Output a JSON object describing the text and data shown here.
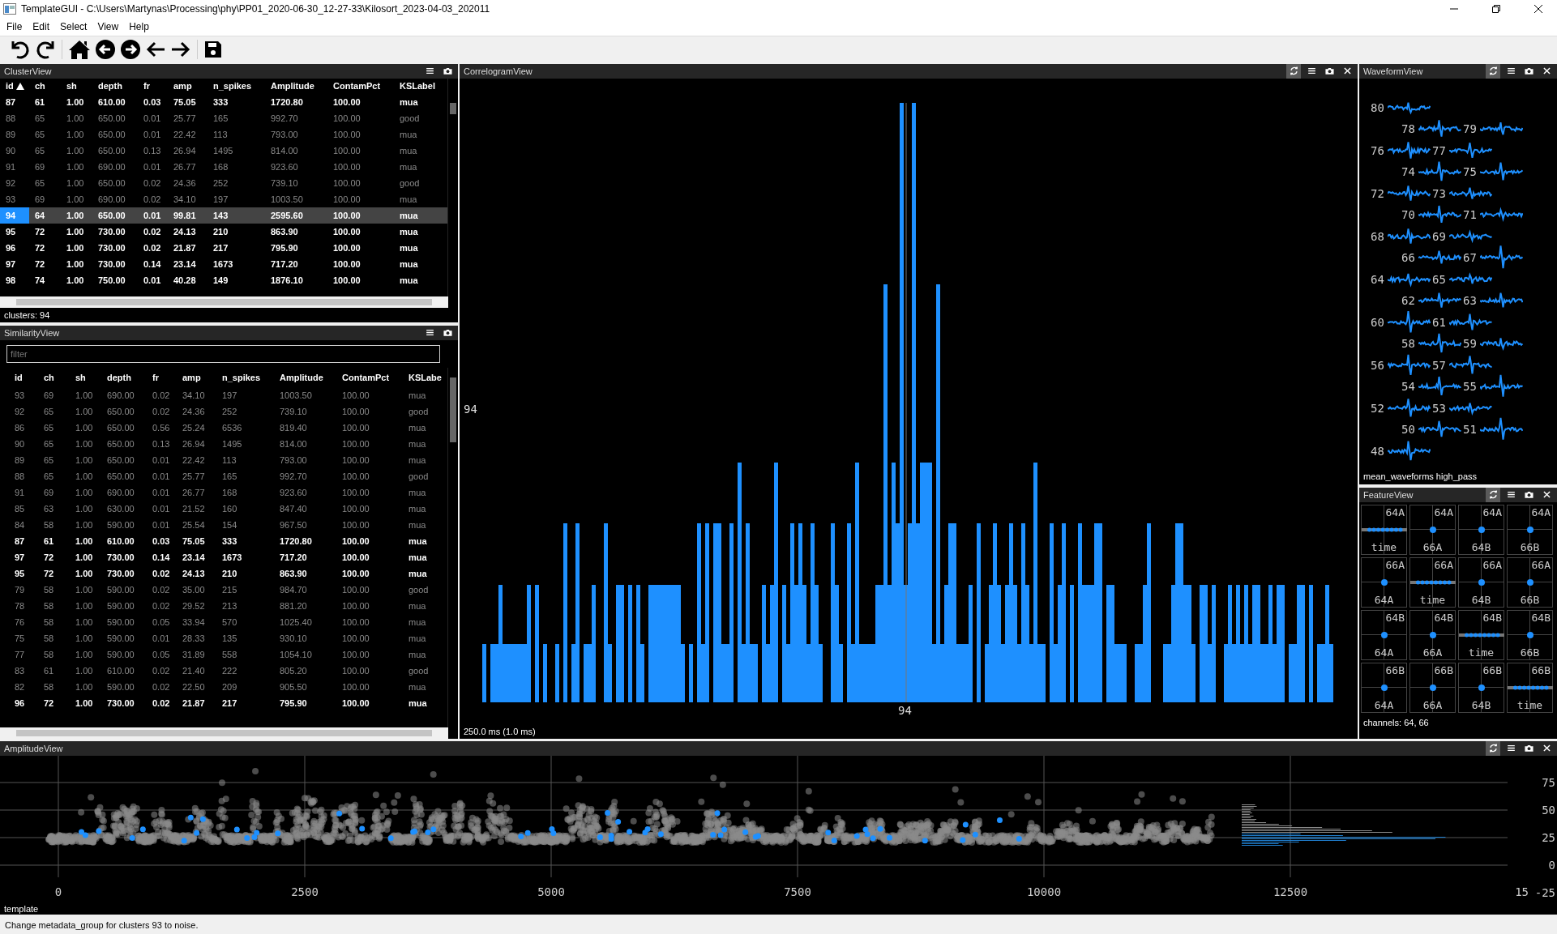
{
  "window": {
    "title": "TemplateGUI - C:\\Users\\Martynas\\Processing\\phy\\PP01_2020-06-30_12-27-33\\Kilosort_2023-04-03_202011"
  },
  "menu": [
    "File",
    "Edit",
    "Select",
    "View",
    "Help"
  ],
  "cluster_view": {
    "title": "ClusterView",
    "closable": false,
    "columns": [
      {
        "label": "id",
        "sorted": true
      },
      {
        "label": "ch",
        "sorted": false
      },
      {
        "label": "sh",
        "sorted": false
      },
      {
        "label": "depth",
        "sorted": false
      },
      {
        "label": "fr",
        "sorted": false
      },
      {
        "label": "amp",
        "sorted": false
      },
      {
        "label": "n_spikes",
        "sorted": false
      },
      {
        "label": "Amplitude",
        "sorted": false
      },
      {
        "label": "ContamPct",
        "sorted": false
      },
      {
        "label": "KSLabel",
        "sorted": false
      }
    ],
    "rows": [
      {
        "cells": [
          "87",
          "61",
          "1.00",
          "610.00",
          "0.03",
          "75.05",
          "333",
          "1720.80",
          "100.00",
          "mua"
        ],
        "emphasized": true,
        "selected": false
      },
      {
        "cells": [
          "88",
          "65",
          "1.00",
          "650.00",
          "0.01",
          "25.77",
          "165",
          "992.70",
          "100.00",
          "good"
        ],
        "emphasized": false,
        "selected": false
      },
      {
        "cells": [
          "89",
          "65",
          "1.00",
          "650.00",
          "0.01",
          "22.42",
          "113",
          "793.00",
          "100.00",
          "mua"
        ],
        "emphasized": false,
        "selected": false
      },
      {
        "cells": [
          "90",
          "65",
          "1.00",
          "650.00",
          "0.13",
          "26.94",
          "1495",
          "814.00",
          "100.00",
          "mua"
        ],
        "emphasized": false,
        "selected": false
      },
      {
        "cells": [
          "91",
          "69",
          "1.00",
          "690.00",
          "0.01",
          "26.77",
          "168",
          "923.60",
          "100.00",
          "mua"
        ],
        "emphasized": false,
        "selected": false
      },
      {
        "cells": [
          "92",
          "65",
          "1.00",
          "650.00",
          "0.02",
          "24.36",
          "252",
          "739.10",
          "100.00",
          "good"
        ],
        "emphasized": false,
        "selected": false
      },
      {
        "cells": [
          "93",
          "69",
          "1.00",
          "690.00",
          "0.02",
          "34.10",
          "197",
          "1003.50",
          "100.00",
          "mua"
        ],
        "emphasized": false,
        "selected": false
      },
      {
        "cells": [
          "94",
          "64",
          "1.00",
          "650.00",
          "0.01",
          "99.81",
          "143",
          "2595.60",
          "100.00",
          "mua"
        ],
        "emphasized": true,
        "selected": true
      },
      {
        "cells": [
          "95",
          "72",
          "1.00",
          "730.00",
          "0.02",
          "24.13",
          "210",
          "863.90",
          "100.00",
          "mua"
        ],
        "emphasized": true,
        "selected": false
      },
      {
        "cells": [
          "96",
          "72",
          "1.00",
          "730.00",
          "0.02",
          "21.87",
          "217",
          "795.90",
          "100.00",
          "mua"
        ],
        "emphasized": true,
        "selected": false
      },
      {
        "cells": [
          "97",
          "72",
          "1.00",
          "730.00",
          "0.14",
          "23.14",
          "1673",
          "717.20",
          "100.00",
          "mua"
        ],
        "emphasized": true,
        "selected": false
      },
      {
        "cells": [
          "98",
          "74",
          "1.00",
          "750.00",
          "0.01",
          "40.28",
          "149",
          "1876.10",
          "100.00",
          "mua"
        ],
        "emphasized": true,
        "selected": false
      }
    ],
    "footer": "clusters: 94"
  },
  "similarity_view": {
    "title": "SimilarityView",
    "closable": false,
    "filter": {
      "placeholder": "filter"
    },
    "columns": [
      {
        "label": "id"
      },
      {
        "label": "ch"
      },
      {
        "label": "sh"
      },
      {
        "label": "depth"
      },
      {
        "label": "fr"
      },
      {
        "label": "amp"
      },
      {
        "label": "n_spikes"
      },
      {
        "label": "Amplitude"
      },
      {
        "label": "ContamPct"
      },
      {
        "label": "KSLabe"
      }
    ],
    "rows": [
      {
        "cells": [
          "93",
          "69",
          "1.00",
          "690.00",
          "0.02",
          "34.10",
          "197",
          "1003.50",
          "100.00",
          "mua"
        ],
        "emphasized": false,
        "selected": false
      },
      {
        "cells": [
          "92",
          "65",
          "1.00",
          "650.00",
          "0.02",
          "24.36",
          "252",
          "739.10",
          "100.00",
          "good"
        ],
        "emphasized": false,
        "selected": false
      },
      {
        "cells": [
          "86",
          "65",
          "1.00",
          "650.00",
          "0.56",
          "25.24",
          "6536",
          "819.40",
          "100.00",
          "mua"
        ],
        "emphasized": false,
        "selected": false
      },
      {
        "cells": [
          "90",
          "65",
          "1.00",
          "650.00",
          "0.13",
          "26.94",
          "1495",
          "814.00",
          "100.00",
          "mua"
        ],
        "emphasized": false,
        "selected": false
      },
      {
        "cells": [
          "89",
          "65",
          "1.00",
          "650.00",
          "0.01",
          "22.42",
          "113",
          "793.00",
          "100.00",
          "mua"
        ],
        "emphasized": false,
        "selected": false
      },
      {
        "cells": [
          "88",
          "65",
          "1.00",
          "650.00",
          "0.01",
          "25.77",
          "165",
          "992.70",
          "100.00",
          "good"
        ],
        "emphasized": false,
        "selected": false
      },
      {
        "cells": [
          "91",
          "69",
          "1.00",
          "690.00",
          "0.01",
          "26.77",
          "168",
          "923.60",
          "100.00",
          "mua"
        ],
        "emphasized": false,
        "selected": false
      },
      {
        "cells": [
          "85",
          "63",
          "1.00",
          "630.00",
          "0.01",
          "21.52",
          "160",
          "847.40",
          "100.00",
          "mua"
        ],
        "emphasized": false,
        "selected": false
      },
      {
        "cells": [
          "84",
          "58",
          "1.00",
          "590.00",
          "0.01",
          "25.54",
          "154",
          "967.50",
          "100.00",
          "mua"
        ],
        "emphasized": false,
        "selected": false
      },
      {
        "cells": [
          "87",
          "61",
          "1.00",
          "610.00",
          "0.03",
          "75.05",
          "333",
          "1720.80",
          "100.00",
          "mua"
        ],
        "emphasized": true,
        "selected": false
      },
      {
        "cells": [
          "97",
          "72",
          "1.00",
          "730.00",
          "0.14",
          "23.14",
          "1673",
          "717.20",
          "100.00",
          "mua"
        ],
        "emphasized": true,
        "selected": false
      },
      {
        "cells": [
          "95",
          "72",
          "1.00",
          "730.00",
          "0.02",
          "24.13",
          "210",
          "863.90",
          "100.00",
          "mua"
        ],
        "emphasized": true,
        "selected": false
      },
      {
        "cells": [
          "79",
          "58",
          "1.00",
          "590.00",
          "0.02",
          "35.00",
          "215",
          "984.70",
          "100.00",
          "good"
        ],
        "emphasized": false,
        "selected": false
      },
      {
        "cells": [
          "78",
          "58",
          "1.00",
          "590.00",
          "0.02",
          "29.52",
          "213",
          "881.20",
          "100.00",
          "mua"
        ],
        "emphasized": false,
        "selected": false
      },
      {
        "cells": [
          "76",
          "58",
          "1.00",
          "590.00",
          "0.05",
          "33.94",
          "570",
          "1025.40",
          "100.00",
          "mua"
        ],
        "emphasized": false,
        "selected": false
      },
      {
        "cells": [
          "75",
          "58",
          "1.00",
          "590.00",
          "0.01",
          "28.33",
          "135",
          "930.10",
          "100.00",
          "mua"
        ],
        "emphasized": false,
        "selected": false
      },
      {
        "cells": [
          "77",
          "58",
          "1.00",
          "590.00",
          "0.05",
          "31.89",
          "558",
          "1054.10",
          "100.00",
          "mua"
        ],
        "emphasized": false,
        "selected": false
      },
      {
        "cells": [
          "83",
          "61",
          "1.00",
          "610.00",
          "0.02",
          "21.40",
          "222",
          "805.20",
          "100.00",
          "good"
        ],
        "emphasized": false,
        "selected": false
      },
      {
        "cells": [
          "82",
          "58",
          "1.00",
          "590.00",
          "0.02",
          "22.50",
          "209",
          "905.50",
          "100.00",
          "mua"
        ],
        "emphasized": false,
        "selected": false
      },
      {
        "cells": [
          "96",
          "72",
          "1.00",
          "730.00",
          "0.02",
          "21.87",
          "217",
          "795.90",
          "100.00",
          "mua"
        ],
        "emphasized": true,
        "selected": false
      }
    ]
  },
  "correlogram_view": {
    "title": "CorrelogramView",
    "closable": true,
    "auto_update": true,
    "y_label": "94",
    "x_label": "94",
    "footer": "250.0 ms (1.0 ms)"
  },
  "waveform_view": {
    "title": "WaveformView",
    "closable": true,
    "auto_update": true,
    "channels": [
      "80",
      "78",
      "79",
      "76",
      "77",
      "74",
      "75",
      "72",
      "73",
      "70",
      "71",
      "68",
      "69",
      "66",
      "67",
      "64",
      "65",
      "62",
      "63",
      "60",
      "61",
      "58",
      "59",
      "56",
      "57",
      "54",
      "55",
      "52",
      "53",
      "50",
      "51",
      "48"
    ],
    "footer": "mean_waveforms high_pass"
  },
  "feature_view": {
    "title": "FeatureView",
    "closable": true,
    "auto_update": true,
    "plots": [
      {
        "top": "64A",
        "bottom": "time",
        "kind": "time"
      },
      {
        "top": "64A",
        "bottom": "66A",
        "kind": "projection"
      },
      {
        "top": "64A",
        "bottom": "64B",
        "kind": "projection"
      },
      {
        "top": "64A",
        "bottom": "66B",
        "kind": "projection"
      },
      {
        "top": "66A",
        "bottom": "64A",
        "kind": "projection"
      },
      {
        "top": "66A",
        "bottom": "time",
        "kind": "time"
      },
      {
        "top": "66A",
        "bottom": "64B",
        "kind": "projection"
      },
      {
        "top": "66A",
        "bottom": "66B",
        "kind": "projection"
      },
      {
        "top": "64B",
        "bottom": "64A",
        "kind": "projection"
      },
      {
        "top": "64B",
        "bottom": "66A",
        "kind": "projection"
      },
      {
        "top": "64B",
        "bottom": "time",
        "kind": "time"
      },
      {
        "top": "64B",
        "bottom": "66B",
        "kind": "projection"
      },
      {
        "top": "66B",
        "bottom": "64A",
        "kind": "projection"
      },
      {
        "top": "66B",
        "bottom": "66A",
        "kind": "projection"
      },
      {
        "top": "66B",
        "bottom": "64B",
        "kind": "projection"
      },
      {
        "top": "66B",
        "bottom": "time",
        "kind": "time"
      }
    ],
    "footer": "channels: 64, 66"
  },
  "amplitude_view": {
    "title": "AmplitudeView",
    "closable": true,
    "auto_update": true,
    "x_ticks": [
      "0",
      "2500",
      "5000",
      "7500",
      "10000",
      "12500",
      "15"
    ],
    "y_ticks": [
      "75",
      "50",
      "25",
      "0",
      "-25"
    ],
    "footer": "template"
  },
  "status_bar": "Change metadata_group for clusters 93 to noise."
}
